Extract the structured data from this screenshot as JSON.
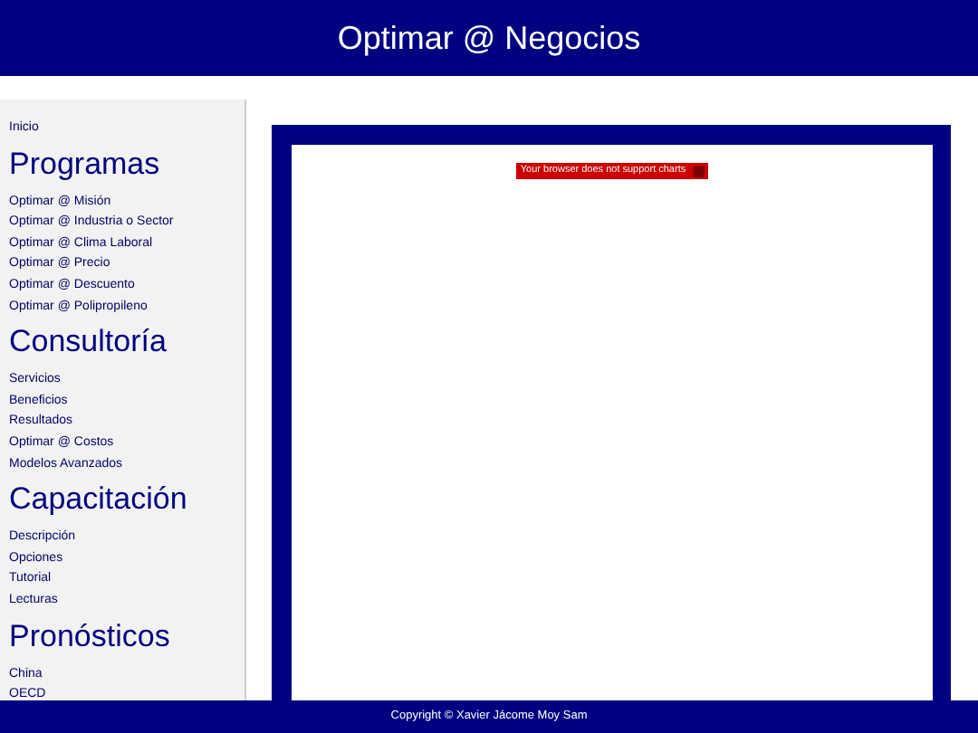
{
  "header": {
    "title": "Optimar @ Negocios"
  },
  "sidebar": {
    "top_link": "Inicio",
    "sections": [
      {
        "heading": "Programas",
        "items": [
          "Optimar @ Misión",
          "Optimar @ Industria o Sector",
          "Optimar @ Clima Laboral",
          "Optimar @ Precio",
          "Optimar @ Descuento",
          "Optimar @ Polipropileno"
        ]
      },
      {
        "heading": "Consultoría",
        "items": [
          "Servicios",
          "Beneficios",
          "Resultados",
          "Optimar @ Costos",
          "Modelos Avanzados"
        ]
      },
      {
        "heading": "Capacitación",
        "items": [
          "Descripción",
          "Opciones",
          "Tutorial",
          "Lecturas"
        ]
      },
      {
        "heading": "Pronósticos",
        "items": [
          "China",
          "OECD"
        ]
      }
    ]
  },
  "chart_panel": {
    "message": "Your browser does not support charts"
  },
  "footer": {
    "copyright": "Copyright © Xavier Jácome Moy Sam"
  }
}
